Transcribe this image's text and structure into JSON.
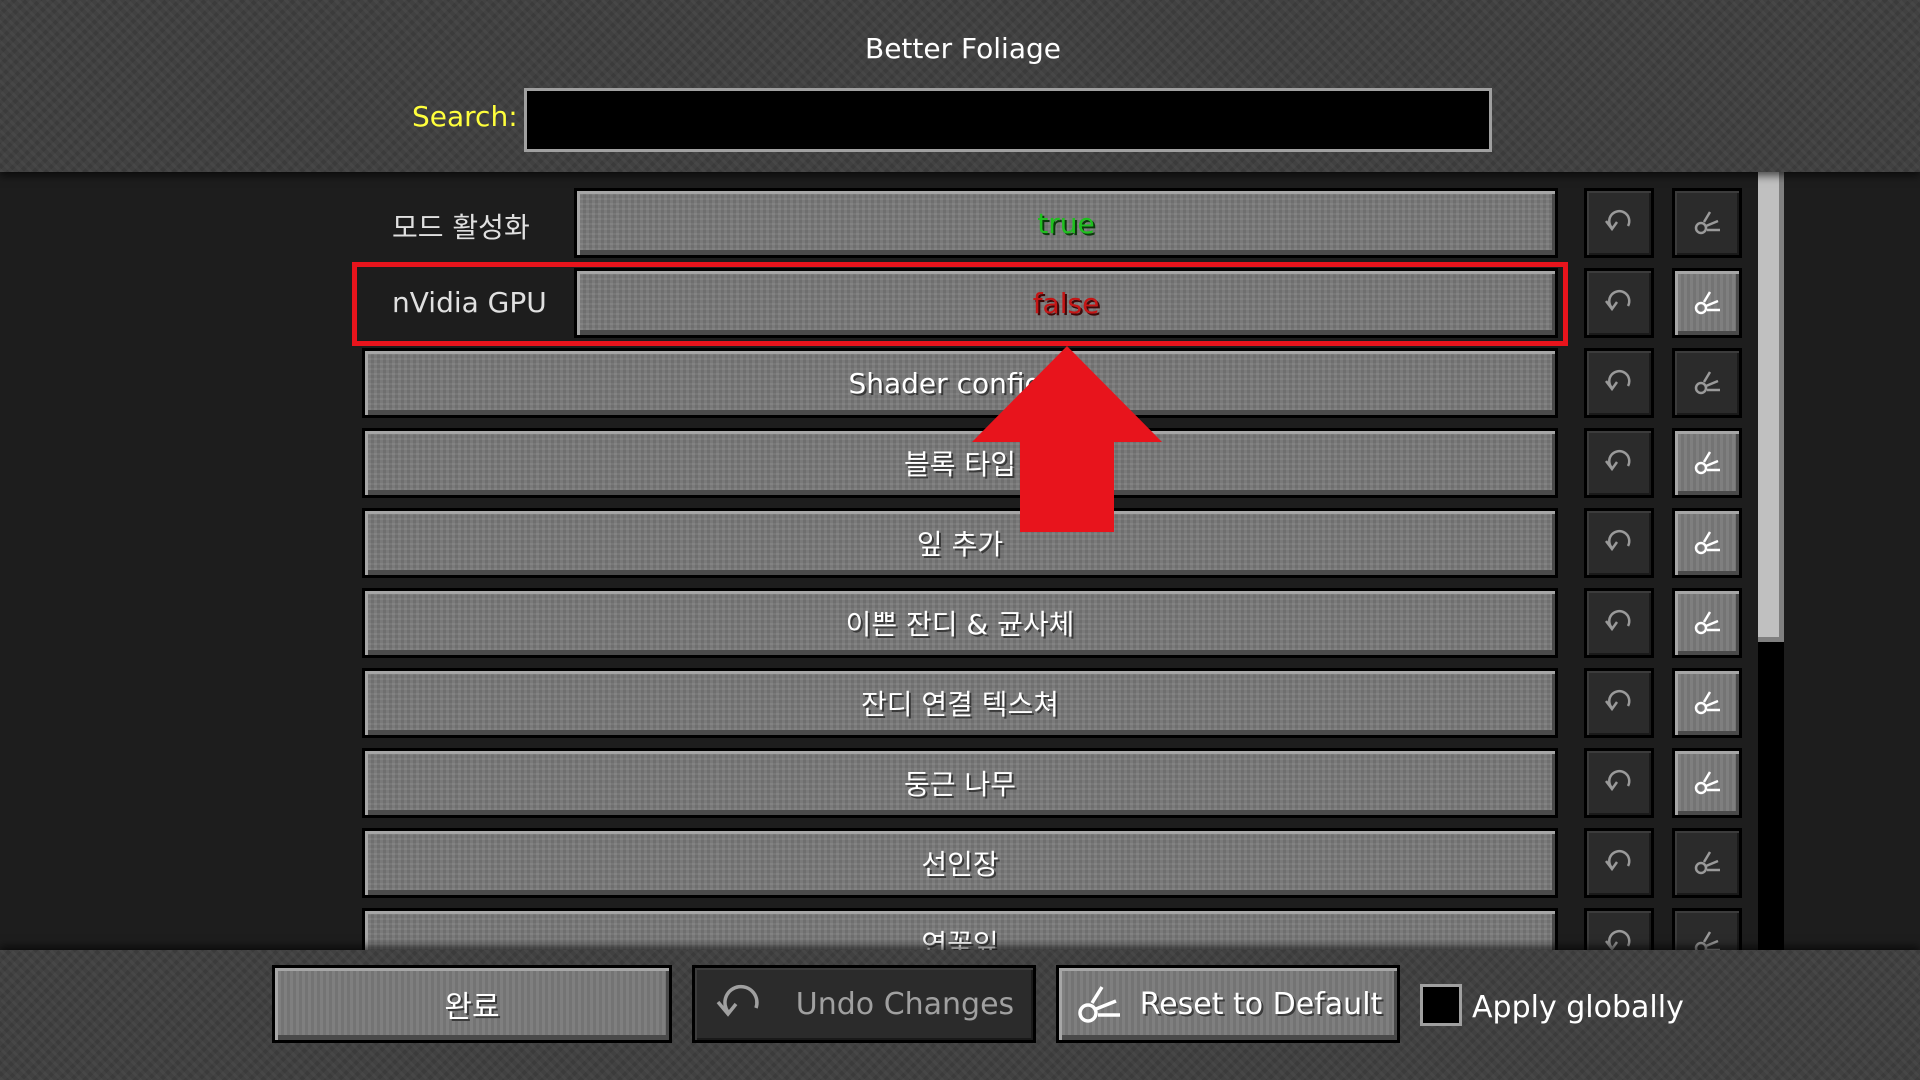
{
  "header": {
    "title": "Better Foliage",
    "search_label": "Search:",
    "search_value": ""
  },
  "entries": [
    {
      "label": "모드 활성화",
      "value": "true"
    },
    {
      "label": "nVidia GPU",
      "value": "false"
    },
    {
      "category": "Shader configur"
    },
    {
      "category": "블록 타입"
    },
    {
      "category": "잎 추가"
    },
    {
      "category": "이쁜 잔디 & 균사체"
    },
    {
      "category": "잔디 연결 텍스쳐"
    },
    {
      "category": "둥근 나무"
    },
    {
      "category": "선인장"
    },
    {
      "category": "연꽃잎"
    }
  ],
  "footer": {
    "done_label": "완료",
    "undo_label": "Undo Changes",
    "reset_label": "Reset to Default",
    "apply_globally_label": "Apply globally",
    "apply_globally_checked": false
  },
  "icons": {
    "undo": "undo-icon",
    "reset": "reset-icon",
    "annotation_arrow": "up-arrow-icon"
  },
  "colors": {
    "true_value": "#1fc01f",
    "false_value": "#c41616",
    "search_label": "#ffff3c",
    "highlight": "#e8141c"
  }
}
